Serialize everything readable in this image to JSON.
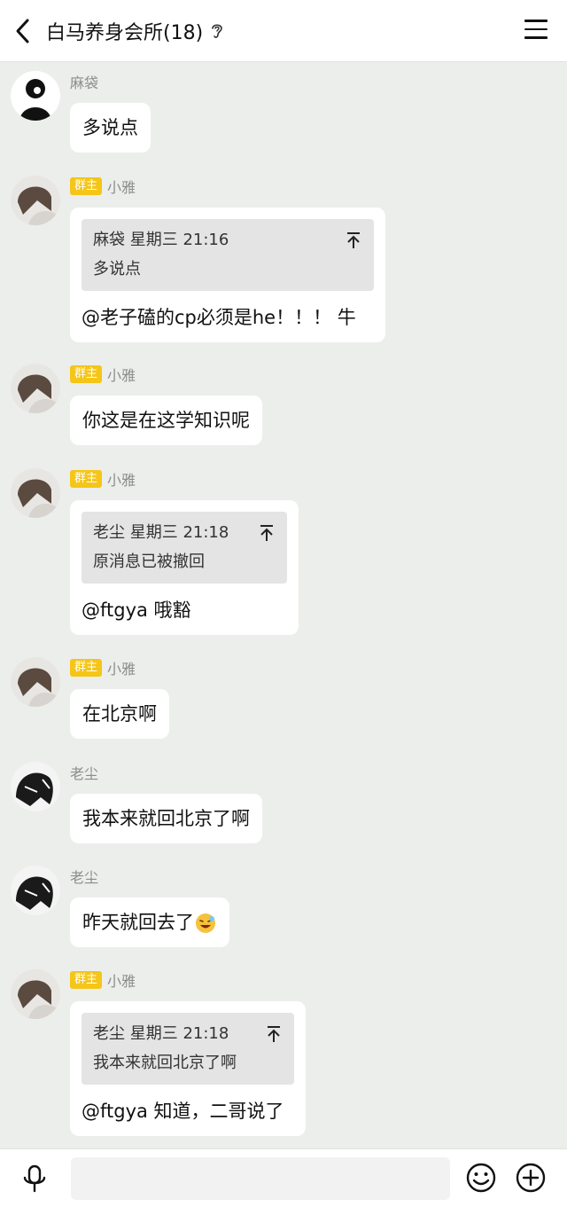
{
  "header": {
    "title": "白马养身会所(18)",
    "back_icon": "chevron-left-icon",
    "ear_icon": "ear-icon",
    "menu_icon": "hamburger-menu-icon"
  },
  "messages": [
    {
      "sender": "麻袋",
      "badge": "",
      "text": "多说点"
    },
    {
      "sender": "小雅",
      "badge": "群主",
      "quote_header": "麻袋 星期三 21:16",
      "quote_body": "多说点",
      "text": "@老子磕的cp必须是he！！！ 牛"
    },
    {
      "sender": "小雅",
      "badge": "群主",
      "text": "你这是在这学知识呢"
    },
    {
      "sender": "小雅",
      "badge": "群主",
      "quote_header": "老尘 星期三 21:18",
      "quote_body": "原消息已被撤回",
      "text": "@ftgya 哦豁"
    },
    {
      "sender": "小雅",
      "badge": "群主",
      "text": "在北京啊"
    },
    {
      "sender": "老尘",
      "badge": "",
      "text": "我本来就回北京了啊"
    },
    {
      "sender": "老尘",
      "badge": "",
      "text": "昨天就回去了"
    },
    {
      "sender": "小雅",
      "badge": "群主",
      "quote_header": "老尘 星期三 21:18",
      "quote_body": "我本来就回北京了啊",
      "text": "@ftgya 知道，二哥说了"
    }
  ],
  "input_bar": {
    "placeholder": "",
    "mic_icon": "microphone-icon",
    "emoji_icon": "smiley-icon",
    "plus_icon": "plus-circle-icon"
  },
  "colors": {
    "badge": "#f5c518",
    "background": "#eceeeb",
    "bubble": "#ffffff",
    "quote": "#e4e4e4"
  }
}
